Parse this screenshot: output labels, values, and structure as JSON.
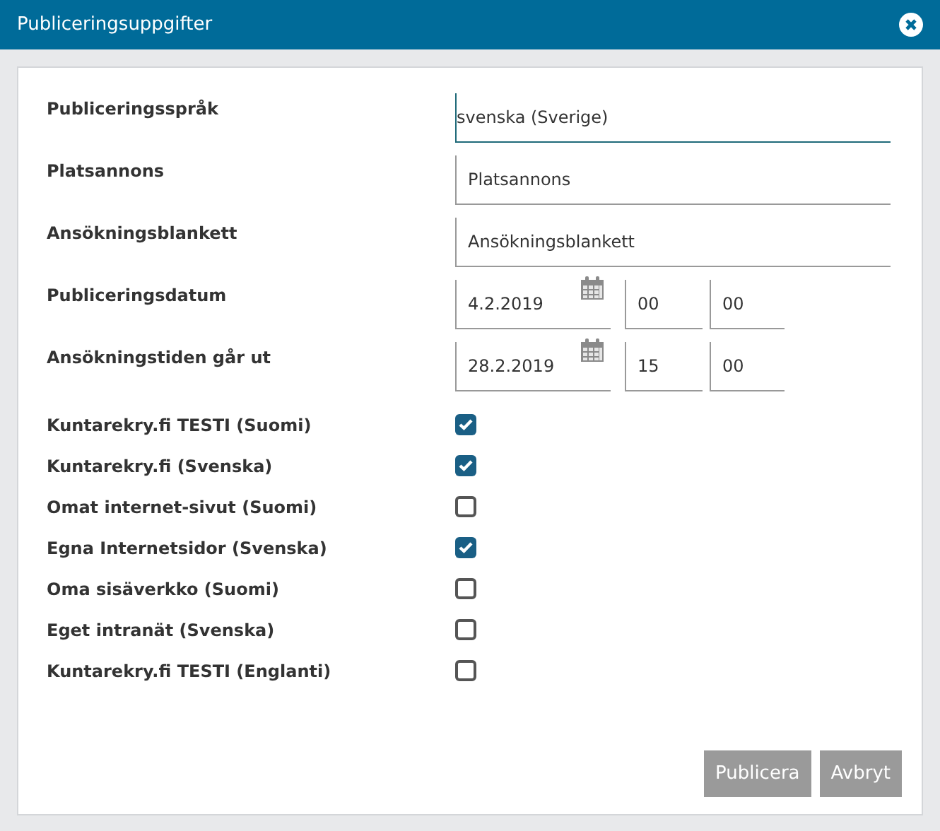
{
  "window": {
    "title": "Publiceringsuppgifter"
  },
  "fields": [
    {
      "kind": "text",
      "label": "Publiceringsspråk",
      "value": "svenska (Sverige)",
      "focused": true
    },
    {
      "kind": "text",
      "label": "Platsannons",
      "value": "Platsannons",
      "focused": false
    },
    {
      "kind": "text",
      "label": "Ansökningsblankett",
      "value": "Ansökningsblankett",
      "focused": false
    },
    {
      "kind": "datetime",
      "label": "Publiceringsdatum",
      "date": "4.2.2019",
      "hour": "00",
      "minute": "00"
    },
    {
      "kind": "datetime",
      "label": "Ansökningstiden går ut",
      "date": "28.2.2019",
      "hour": "15",
      "minute": "00"
    }
  ],
  "channels": [
    {
      "label": "Kuntarekry.fi TESTI (Suomi)",
      "checked": true
    },
    {
      "label": "Kuntarekry.fi (Svenska)",
      "checked": true
    },
    {
      "label": "Omat internet-sivut (Suomi)",
      "checked": false
    },
    {
      "label": "Egna Internetsidor (Svenska)",
      "checked": true
    },
    {
      "label": "Oma sisäverkko (Suomi)",
      "checked": false
    },
    {
      "label": "Eget intranät (Svenska)",
      "checked": false
    },
    {
      "label": "Kuntarekry.fi TESTI (Englanti)",
      "checked": false
    }
  ],
  "buttons": [
    {
      "label": "Publicera",
      "disabled": true
    },
    {
      "label": "Avbryt",
      "disabled": true
    }
  ]
}
